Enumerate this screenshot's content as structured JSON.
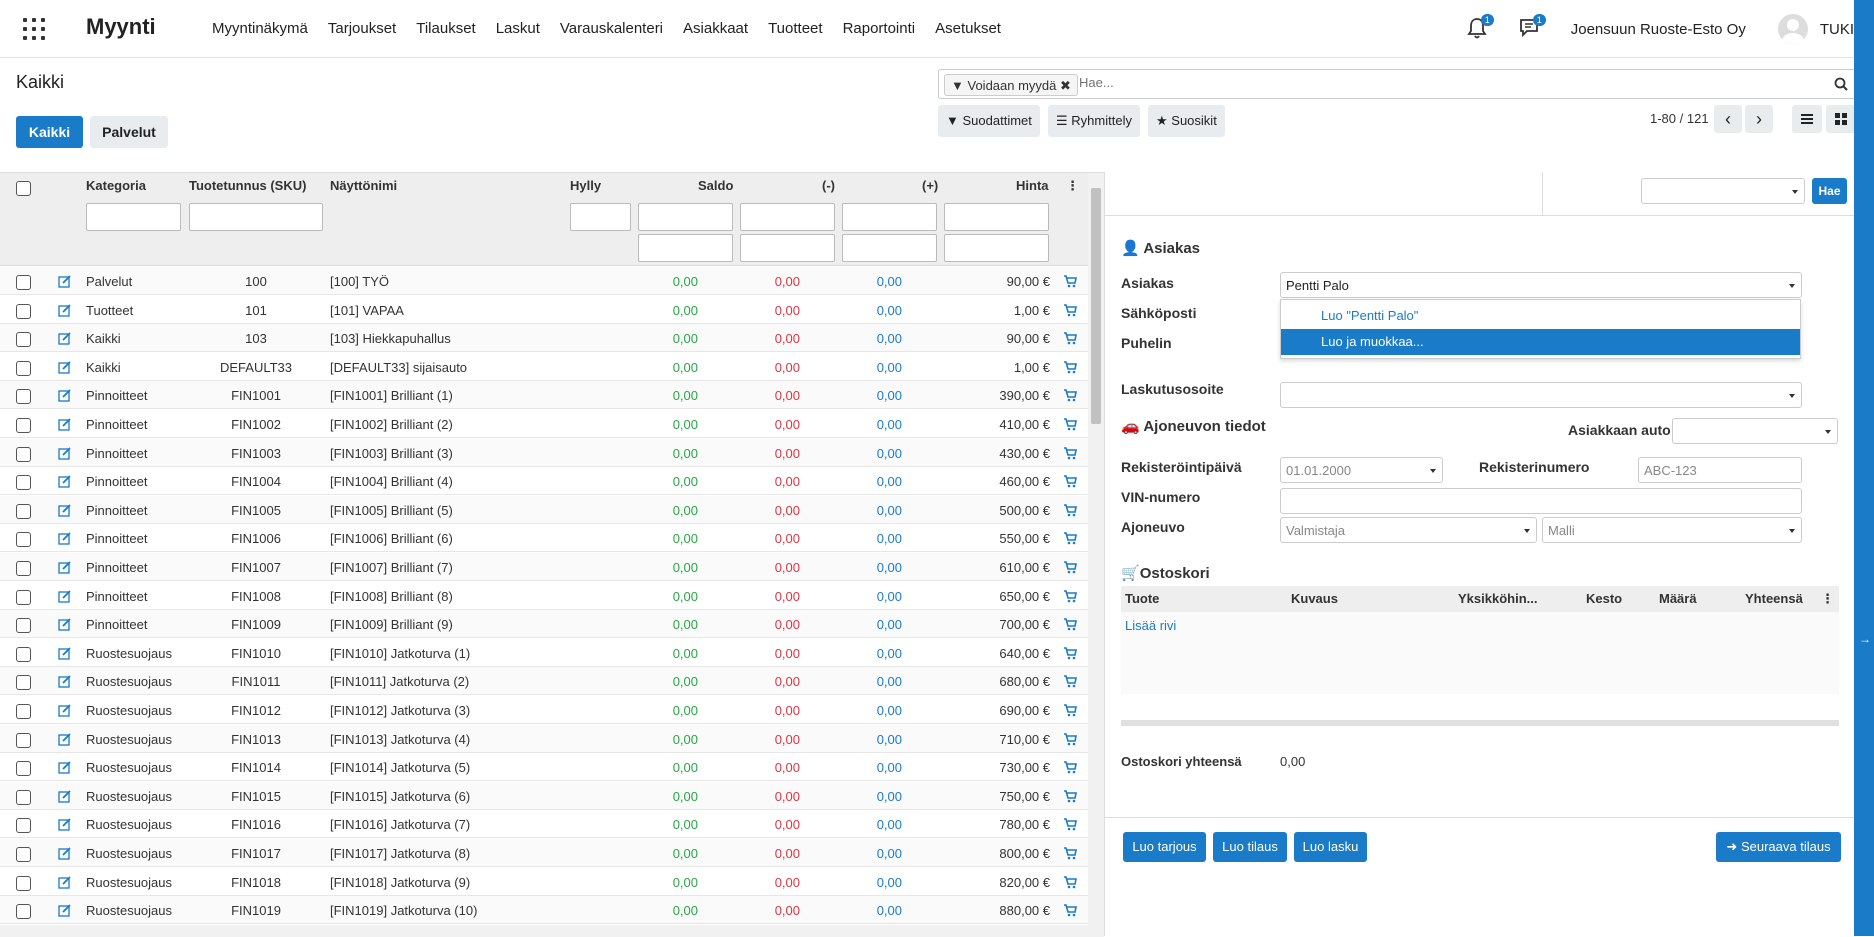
{
  "navbar": {
    "brand": "Myynti",
    "menu": [
      "Myyntinäkymä",
      "Tarjoukset",
      "Tilaukset",
      "Laskut",
      "Varauskalenteri",
      "Asiakkaat",
      "Tuotteet",
      "Raportointi",
      "Asetukset"
    ],
    "notif_count": "1",
    "msg_count": "1",
    "company": "Joensuun Ruoste-Esto Oy",
    "user": "TUKI"
  },
  "control": {
    "title": "Kaikki",
    "btn_all": "Kaikki",
    "btn_services": "Palvelut",
    "facet": "Voidaan myydä",
    "search_placeholder": "Hae...",
    "filters": "Suodattimet",
    "group": "Ryhmittely",
    "favorites": "Suosikit",
    "pager": "1-80 / 121"
  },
  "list": {
    "headers": {
      "category": "Kategoria",
      "sku": "Tuotetunnus (SKU)",
      "name": "Näyttönimi",
      "shelf": "Hylly",
      "saldo": "Saldo",
      "minus": "(-)",
      "plus": "(+)",
      "price": "Hinta"
    },
    "rows": [
      {
        "cat": "Palvelut",
        "sku": "100",
        "name": "[100] TYÖ",
        "saldo": "0,00",
        "minus": "0,00",
        "plus": "0,00",
        "price": "90,00 €"
      },
      {
        "cat": "Tuotteet",
        "sku": "101",
        "name": "[101] VAPAA",
        "saldo": "0,00",
        "minus": "0,00",
        "plus": "0,00",
        "price": "1,00 €"
      },
      {
        "cat": "Kaikki",
        "sku": "103",
        "name": "[103] Hiekkapuhallus",
        "saldo": "0,00",
        "minus": "0,00",
        "plus": "0,00",
        "price": "90,00 €"
      },
      {
        "cat": "Kaikki",
        "sku": "DEFAULT33",
        "name": "[DEFAULT33] sijaisauto",
        "saldo": "0,00",
        "minus": "0,00",
        "plus": "0,00",
        "price": "1,00 €"
      },
      {
        "cat": "Pinnoitteet",
        "sku": "FIN1001",
        "name": "[FIN1001] Brilliant (1)",
        "saldo": "0,00",
        "minus": "0,00",
        "plus": "0,00",
        "price": "390,00 €"
      },
      {
        "cat": "Pinnoitteet",
        "sku": "FIN1002",
        "name": "[FIN1002] Brilliant (2)",
        "saldo": "0,00",
        "minus": "0,00",
        "plus": "0,00",
        "price": "410,00 €"
      },
      {
        "cat": "Pinnoitteet",
        "sku": "FIN1003",
        "name": "[FIN1003] Brilliant (3)",
        "saldo": "0,00",
        "minus": "0,00",
        "plus": "0,00",
        "price": "430,00 €"
      },
      {
        "cat": "Pinnoitteet",
        "sku": "FIN1004",
        "name": "[FIN1004] Brilliant (4)",
        "saldo": "0,00",
        "minus": "0,00",
        "plus": "0,00",
        "price": "460,00 €"
      },
      {
        "cat": "Pinnoitteet",
        "sku": "FIN1005",
        "name": "[FIN1005] Brilliant (5)",
        "saldo": "0,00",
        "minus": "0,00",
        "plus": "0,00",
        "price": "500,00 €"
      },
      {
        "cat": "Pinnoitteet",
        "sku": "FIN1006",
        "name": "[FIN1006] Brilliant (6)",
        "saldo": "0,00",
        "minus": "0,00",
        "plus": "0,00",
        "price": "550,00 €"
      },
      {
        "cat": "Pinnoitteet",
        "sku": "FIN1007",
        "name": "[FIN1007] Brilliant (7)",
        "saldo": "0,00",
        "minus": "0,00",
        "plus": "0,00",
        "price": "610,00 €"
      },
      {
        "cat": "Pinnoitteet",
        "sku": "FIN1008",
        "name": "[FIN1008] Brilliant (8)",
        "saldo": "0,00",
        "minus": "0,00",
        "plus": "0,00",
        "price": "650,00 €"
      },
      {
        "cat": "Pinnoitteet",
        "sku": "FIN1009",
        "name": "[FIN1009] Brilliant (9)",
        "saldo": "0,00",
        "minus": "0,00",
        "plus": "0,00",
        "price": "700,00 €"
      },
      {
        "cat": "Ruostesuojaus",
        "sku": "FIN1010",
        "name": "[FIN1010] Jatkoturva (1)",
        "saldo": "0,00",
        "minus": "0,00",
        "plus": "0,00",
        "price": "640,00 €"
      },
      {
        "cat": "Ruostesuojaus",
        "sku": "FIN1011",
        "name": "[FIN1011] Jatkoturva (2)",
        "saldo": "0,00",
        "minus": "0,00",
        "plus": "0,00",
        "price": "680,00 €"
      },
      {
        "cat": "Ruostesuojaus",
        "sku": "FIN1012",
        "name": "[FIN1012] Jatkoturva (3)",
        "saldo": "0,00",
        "minus": "0,00",
        "plus": "0,00",
        "price": "690,00 €"
      },
      {
        "cat": "Ruostesuojaus",
        "sku": "FIN1013",
        "name": "[FIN1013] Jatkoturva (4)",
        "saldo": "0,00",
        "minus": "0,00",
        "plus": "0,00",
        "price": "710,00 €"
      },
      {
        "cat": "Ruostesuojaus",
        "sku": "FIN1014",
        "name": "[FIN1014] Jatkoturva (5)",
        "saldo": "0,00",
        "minus": "0,00",
        "plus": "0,00",
        "price": "730,00 €"
      },
      {
        "cat": "Ruostesuojaus",
        "sku": "FIN1015",
        "name": "[FIN1015] Jatkoturva (6)",
        "saldo": "0,00",
        "minus": "0,00",
        "plus": "0,00",
        "price": "750,00 €"
      },
      {
        "cat": "Ruostesuojaus",
        "sku": "FIN1016",
        "name": "[FIN1016] Jatkoturva (7)",
        "saldo": "0,00",
        "minus": "0,00",
        "plus": "0,00",
        "price": "780,00 €"
      },
      {
        "cat": "Ruostesuojaus",
        "sku": "FIN1017",
        "name": "[FIN1017] Jatkoturva (8)",
        "saldo": "0,00",
        "minus": "0,00",
        "plus": "0,00",
        "price": "800,00 €"
      },
      {
        "cat": "Ruostesuojaus",
        "sku": "FIN1018",
        "name": "[FIN1018] Jatkoturva (9)",
        "saldo": "0,00",
        "minus": "0,00",
        "plus": "0,00",
        "price": "820,00 €"
      },
      {
        "cat": "Ruostesuojaus",
        "sku": "FIN1019",
        "name": "[FIN1019] Jatkoturva (10)",
        "saldo": "0,00",
        "minus": "0,00",
        "plus": "0,00",
        "price": "880,00 €"
      }
    ]
  },
  "panel": {
    "hae": "Hae",
    "customer_section": "Asiakas",
    "customer_label": "Asiakas",
    "customer_value": "Pentti Palo",
    "email_label": "Sähköposti",
    "phone_label": "Puhelin",
    "dropdown": [
      "Luo \"Pentti Palo\"",
      "Luo ja muokkaa..."
    ],
    "billing_label": "Laskutusosoite",
    "vehicle_section": "Ajoneuvon tiedot",
    "customer_car_label": "Asiakkaan auto:",
    "reg_date_label": "Rekisteröintipäivä",
    "reg_date_value": "01.01.2000",
    "reg_no_label": "Rekisterinumero",
    "reg_no_placeholder": "ABC-123",
    "vin_label": "VIN-numero",
    "vehicle_label": "Ajoneuvo",
    "maker_placeholder": "Valmistaja",
    "model_placeholder": "Malli",
    "cart_section": "Ostoskori",
    "cart_headers": [
      "Tuote",
      "Kuvaus",
      "Yksikköhin...",
      "Kesto",
      "Määrä",
      "Yhteensä"
    ],
    "add_row": "Lisää rivi",
    "cart_total_label": "Ostoskori yhteensä",
    "cart_total_value": "0,00",
    "btn_quote": "Luo tarjous",
    "btn_order": "Luo tilaus",
    "btn_invoice": "Luo lasku",
    "btn_next": "Seuraava tilaus"
  },
  "colors": {
    "accent": "#1a7bc8",
    "positive": "#28a745",
    "negative": "#dc3545"
  }
}
